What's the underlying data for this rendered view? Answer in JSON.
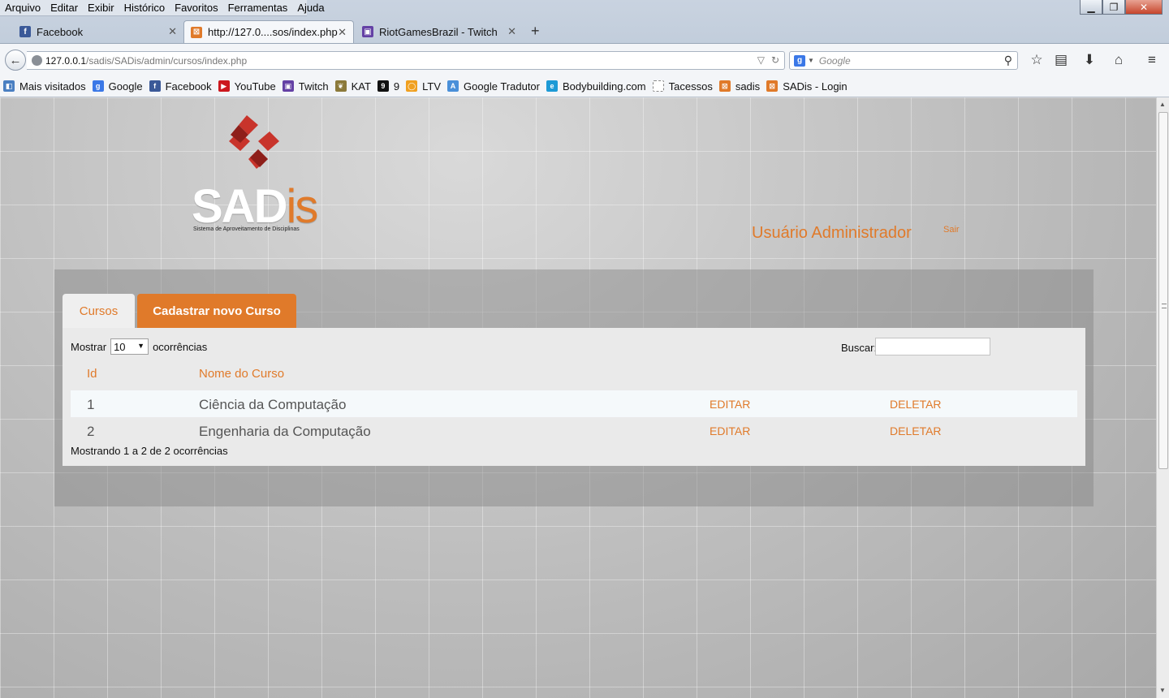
{
  "menu": [
    "Arquivo",
    "Editar",
    "Exibir",
    "Histórico",
    "Favoritos",
    "Ferramentas",
    "Ajuda"
  ],
  "window_controls": {
    "minimize": "▁",
    "maximize": "❐",
    "close": "✕"
  },
  "tabs": [
    {
      "label": "Facebook",
      "icon": "facebook-icon",
      "icon_glyph": "f",
      "icon_color": "#3b5998",
      "active": false
    },
    {
      "label": "http://127.0....sos/index.php",
      "icon": "sadis-favicon-icon",
      "icon_glyph": "⊠",
      "icon_color": "#e07a2a",
      "active": true
    },
    {
      "label": "RiotGamesBrazil - Twitch",
      "icon": "twitch-icon",
      "icon_glyph": "▣",
      "icon_color": "#6441a5",
      "active": false
    }
  ],
  "tab_close_glyph": "✕",
  "new_tab_glyph": "+",
  "url": {
    "host": "127.0.0.1",
    "path": "/sadis/SADis/admin/cursos/index.php"
  },
  "search": {
    "placeholder": "Google",
    "engine_glyph": "g"
  },
  "bookmarks": [
    {
      "label": "Mais visitados",
      "icon": "mais-visitados-icon",
      "glyph": "◧",
      "color": "#4a7fc1"
    },
    {
      "label": "Google",
      "icon": "google-icon",
      "glyph": "g",
      "color": "#3b78e7"
    },
    {
      "label": "Facebook",
      "icon": "facebook-icon",
      "glyph": "f",
      "color": "#3b5998"
    },
    {
      "label": "YouTube",
      "icon": "youtube-icon",
      "glyph": "▶",
      "color": "#cc181e"
    },
    {
      "label": "Twitch",
      "icon": "twitch-icon",
      "glyph": "▣",
      "color": "#6441a5"
    },
    {
      "label": "KAT",
      "icon": "kat-icon",
      "glyph": "❦",
      "color": "#8c7a3a"
    },
    {
      "label": "9",
      "icon": "nine-icon",
      "glyph": "9",
      "color": "#111111"
    },
    {
      "label": "LTV",
      "icon": "ltv-icon",
      "glyph": "◯",
      "color": "#f0a020"
    },
    {
      "label": "Google Tradutor",
      "icon": "google-tradutor-icon",
      "glyph": "A",
      "color": "#4a90d9"
    },
    {
      "label": "Bodybuilding.com",
      "icon": "bodybuilding-icon",
      "glyph": "e",
      "color": "#1d9ad6"
    },
    {
      "label": "Tacessos",
      "icon": "tacessos-icon",
      "glyph": "",
      "color": "#ffffff"
    },
    {
      "label": "sadis",
      "icon": "sadis-favicon-icon",
      "glyph": "⊠",
      "color": "#e07a2a"
    },
    {
      "label": "SADis - Login",
      "icon": "sadis-favicon-icon",
      "glyph": "⊠",
      "color": "#e07a2a"
    }
  ],
  "logo": {
    "word_main": "SAD",
    "word_accent": "is",
    "tagline": "Sistema de Aproveitamento de Disciplinas"
  },
  "header": {
    "user": "Usuário Administrador",
    "logout": "Sair"
  },
  "page_tabs": {
    "active": "Cursos",
    "secondary": "Cadastrar novo Curso"
  },
  "table_controls": {
    "show_prefix": "Mostrar",
    "show_value": "10",
    "show_suffix": "ocorrências",
    "search_label": "Buscar:"
  },
  "table": {
    "columns": [
      "Id",
      "Nome do Curso"
    ],
    "rows": [
      {
        "id": "1",
        "name": "Ciência da Computação",
        "edit": "EDITAR",
        "delete": "DELETAR"
      },
      {
        "id": "2",
        "name": "Engenharia da Computação",
        "edit": "EDITAR",
        "delete": "DELETAR"
      }
    ],
    "info": "Mostrando 1 a 2 de 2 ocorrências"
  },
  "colors": {
    "accent": "#e07a2a",
    "logo_red": "#c8342b"
  }
}
